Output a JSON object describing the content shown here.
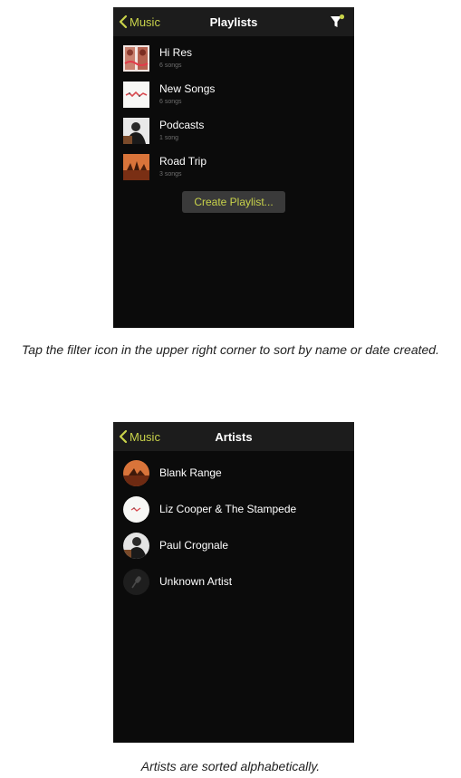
{
  "colors": {
    "accent": "#c8d24a",
    "screen_bg": "#0b0b0b",
    "navbar_bg": "#1c1c1c",
    "button_bg": "#3a3a3a",
    "subtitle": "#6f6f6f"
  },
  "playlists_screen": {
    "back_label": "Music",
    "title": "Playlists",
    "filter_icon": "filter-icon",
    "items": [
      {
        "title": "Hi Res",
        "subtitle": "6 songs",
        "art": "hi-res-art"
      },
      {
        "title": "New Songs",
        "subtitle": "6 songs",
        "art": "new-songs-art"
      },
      {
        "title": "Podcasts",
        "subtitle": "1 song",
        "art": "podcasts-art"
      },
      {
        "title": "Road Trip",
        "subtitle": "3 songs",
        "art": "road-trip-art"
      }
    ],
    "create_button": "Create Playlist..."
  },
  "caption_1": "Tap the filter icon in the upper right corner to sort by name or date created.",
  "artists_screen": {
    "back_label": "Music",
    "title": "Artists",
    "items": [
      {
        "name": "Blank Range",
        "art": "blank-range-avatar"
      },
      {
        "name": "Liz Cooper & The Stampede",
        "art": "liz-cooper-avatar"
      },
      {
        "name": "Paul Crognale",
        "art": "paul-crognale-avatar"
      },
      {
        "name": "Unknown Artist",
        "art": "microphone-icon"
      }
    ]
  },
  "caption_2": "Artists are sorted alphabetically."
}
